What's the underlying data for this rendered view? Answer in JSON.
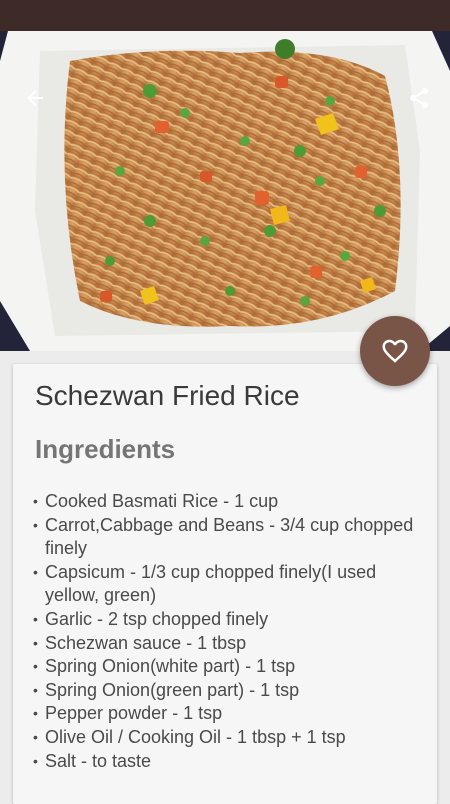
{
  "recipe": {
    "title": "Schezwan Fried Rice",
    "ingredients_heading": "Ingredients",
    "ingredients": [
      "Cooked Basmati Rice - 1 cup",
      "Carrot,Cabbage and Beans - 3/4 cup chopped finely",
      "Capsicum - 1/3 cup chopped finely(I used yellow, green)",
      "Garlic - 2 tsp chopped  finely",
      "Schezwan sauce - 1 tbsp",
      "Spring Onion(white part) - 1 tsp",
      "Spring Onion(green part) - 1 tsp",
      "Pepper powder - 1 tsp",
      "Olive Oil / Cooking Oil - 1 tbsp + 1 tsp",
      "Salt - to taste"
    ]
  },
  "toolbar": {
    "back_icon": "arrow-back-icon",
    "share_icon": "share-icon"
  },
  "fab": {
    "icon": "heart-outline-icon"
  },
  "colors": {
    "status_bar": "#3e2a27",
    "accent": "#795548",
    "card": "#f6f6f6",
    "background": "#ececec"
  }
}
